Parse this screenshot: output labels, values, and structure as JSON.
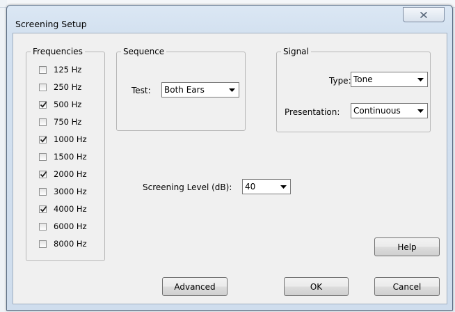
{
  "window": {
    "title": "Screening Setup"
  },
  "frequencies": {
    "label": "Frequencies",
    "items": [
      {
        "label": "125 Hz",
        "checked": false
      },
      {
        "label": "250 Hz",
        "checked": false
      },
      {
        "label": "500 Hz",
        "checked": true
      },
      {
        "label": "750 Hz",
        "checked": false
      },
      {
        "label": "1000 Hz",
        "checked": true
      },
      {
        "label": "1500 Hz",
        "checked": false
      },
      {
        "label": "2000 Hz",
        "checked": true
      },
      {
        "label": "3000 Hz",
        "checked": false
      },
      {
        "label": "4000 Hz",
        "checked": true
      },
      {
        "label": "6000 Hz",
        "checked": false
      },
      {
        "label": "8000 Hz",
        "checked": false
      }
    ]
  },
  "sequence": {
    "label": "Sequence",
    "test_label": "Test:",
    "test_value": "Both Ears"
  },
  "signal": {
    "label": "Signal",
    "type_label": "Type:",
    "type_value": "Tone",
    "presentation_label": "Presentation:",
    "presentation_value": "Continuous"
  },
  "screening_level": {
    "label": "Screening Level (dB):",
    "value": "40"
  },
  "buttons": {
    "help": "Help",
    "advanced": "Advanced",
    "ok": "OK",
    "cancel": "Cancel"
  },
  "icons": {
    "close": "close-icon",
    "dropdown": "chevron-down-icon",
    "check": "check-icon"
  }
}
